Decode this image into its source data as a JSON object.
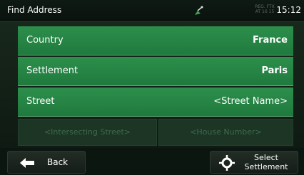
{
  "status_bar": {
    "title": "Find Address",
    "gps_info_line1": "REG. FTX",
    "gps_info_line2": "AT 16 15",
    "time": "15:12",
    "icons": {
      "gps": "satellite-dish-icon"
    }
  },
  "fields": {
    "country": {
      "label": "Country",
      "value": "France"
    },
    "settlement": {
      "label": "Settlement",
      "value": "Paris"
    },
    "street": {
      "label": "Street",
      "value": "<Street Name>"
    }
  },
  "disabled": {
    "intersecting": "<Intersecting Street>",
    "house_number": "<House Number>"
  },
  "bottom_bar": {
    "back_label": "Back",
    "select_line1": "Select",
    "select_line2": "Settlement",
    "icons": {
      "back": "back-arrow-icon",
      "select": "crosshair-icon"
    }
  },
  "colors": {
    "row_green": "#2d8f4c",
    "disabled_green": "#1c3525",
    "background": "#0e1a12"
  }
}
